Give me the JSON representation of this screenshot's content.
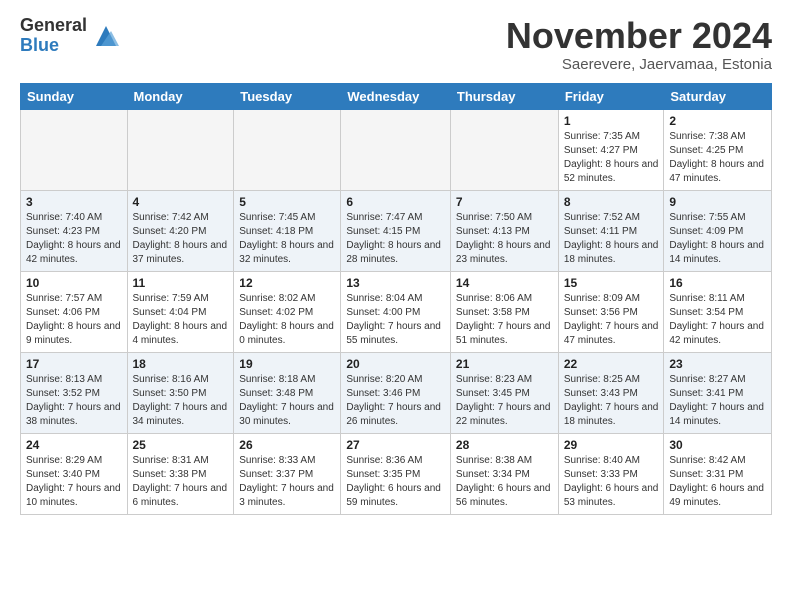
{
  "logo": {
    "general": "General",
    "blue": "Blue"
  },
  "title": "November 2024",
  "subtitle": "Saerevere, Jaervamaa, Estonia",
  "days_of_week": [
    "Sunday",
    "Monday",
    "Tuesday",
    "Wednesday",
    "Thursday",
    "Friday",
    "Saturday"
  ],
  "weeks": [
    [
      {
        "day": "",
        "info": ""
      },
      {
        "day": "",
        "info": ""
      },
      {
        "day": "",
        "info": ""
      },
      {
        "day": "",
        "info": ""
      },
      {
        "day": "",
        "info": ""
      },
      {
        "day": "1",
        "info": "Sunrise: 7:35 AM\nSunset: 4:27 PM\nDaylight: 8 hours and 52 minutes."
      },
      {
        "day": "2",
        "info": "Sunrise: 7:38 AM\nSunset: 4:25 PM\nDaylight: 8 hours and 47 minutes."
      }
    ],
    [
      {
        "day": "3",
        "info": "Sunrise: 7:40 AM\nSunset: 4:23 PM\nDaylight: 8 hours and 42 minutes."
      },
      {
        "day": "4",
        "info": "Sunrise: 7:42 AM\nSunset: 4:20 PM\nDaylight: 8 hours and 37 minutes."
      },
      {
        "day": "5",
        "info": "Sunrise: 7:45 AM\nSunset: 4:18 PM\nDaylight: 8 hours and 32 minutes."
      },
      {
        "day": "6",
        "info": "Sunrise: 7:47 AM\nSunset: 4:15 PM\nDaylight: 8 hours and 28 minutes."
      },
      {
        "day": "7",
        "info": "Sunrise: 7:50 AM\nSunset: 4:13 PM\nDaylight: 8 hours and 23 minutes."
      },
      {
        "day": "8",
        "info": "Sunrise: 7:52 AM\nSunset: 4:11 PM\nDaylight: 8 hours and 18 minutes."
      },
      {
        "day": "9",
        "info": "Sunrise: 7:55 AM\nSunset: 4:09 PM\nDaylight: 8 hours and 14 minutes."
      }
    ],
    [
      {
        "day": "10",
        "info": "Sunrise: 7:57 AM\nSunset: 4:06 PM\nDaylight: 8 hours and 9 minutes."
      },
      {
        "day": "11",
        "info": "Sunrise: 7:59 AM\nSunset: 4:04 PM\nDaylight: 8 hours and 4 minutes."
      },
      {
        "day": "12",
        "info": "Sunrise: 8:02 AM\nSunset: 4:02 PM\nDaylight: 8 hours and 0 minutes."
      },
      {
        "day": "13",
        "info": "Sunrise: 8:04 AM\nSunset: 4:00 PM\nDaylight: 7 hours and 55 minutes."
      },
      {
        "day": "14",
        "info": "Sunrise: 8:06 AM\nSunset: 3:58 PM\nDaylight: 7 hours and 51 minutes."
      },
      {
        "day": "15",
        "info": "Sunrise: 8:09 AM\nSunset: 3:56 PM\nDaylight: 7 hours and 47 minutes."
      },
      {
        "day": "16",
        "info": "Sunrise: 8:11 AM\nSunset: 3:54 PM\nDaylight: 7 hours and 42 minutes."
      }
    ],
    [
      {
        "day": "17",
        "info": "Sunrise: 8:13 AM\nSunset: 3:52 PM\nDaylight: 7 hours and 38 minutes."
      },
      {
        "day": "18",
        "info": "Sunrise: 8:16 AM\nSunset: 3:50 PM\nDaylight: 7 hours and 34 minutes."
      },
      {
        "day": "19",
        "info": "Sunrise: 8:18 AM\nSunset: 3:48 PM\nDaylight: 7 hours and 30 minutes."
      },
      {
        "day": "20",
        "info": "Sunrise: 8:20 AM\nSunset: 3:46 PM\nDaylight: 7 hours and 26 minutes."
      },
      {
        "day": "21",
        "info": "Sunrise: 8:23 AM\nSunset: 3:45 PM\nDaylight: 7 hours and 22 minutes."
      },
      {
        "day": "22",
        "info": "Sunrise: 8:25 AM\nSunset: 3:43 PM\nDaylight: 7 hours and 18 minutes."
      },
      {
        "day": "23",
        "info": "Sunrise: 8:27 AM\nSunset: 3:41 PM\nDaylight: 7 hours and 14 minutes."
      }
    ],
    [
      {
        "day": "24",
        "info": "Sunrise: 8:29 AM\nSunset: 3:40 PM\nDaylight: 7 hours and 10 minutes."
      },
      {
        "day": "25",
        "info": "Sunrise: 8:31 AM\nSunset: 3:38 PM\nDaylight: 7 hours and 6 minutes."
      },
      {
        "day": "26",
        "info": "Sunrise: 8:33 AM\nSunset: 3:37 PM\nDaylight: 7 hours and 3 minutes."
      },
      {
        "day": "27",
        "info": "Sunrise: 8:36 AM\nSunset: 3:35 PM\nDaylight: 6 hours and 59 minutes."
      },
      {
        "day": "28",
        "info": "Sunrise: 8:38 AM\nSunset: 3:34 PM\nDaylight: 6 hours and 56 minutes."
      },
      {
        "day": "29",
        "info": "Sunrise: 8:40 AM\nSunset: 3:33 PM\nDaylight: 6 hours and 53 minutes."
      },
      {
        "day": "30",
        "info": "Sunrise: 8:42 AM\nSunset: 3:31 PM\nDaylight: 6 hours and 49 minutes."
      }
    ]
  ]
}
